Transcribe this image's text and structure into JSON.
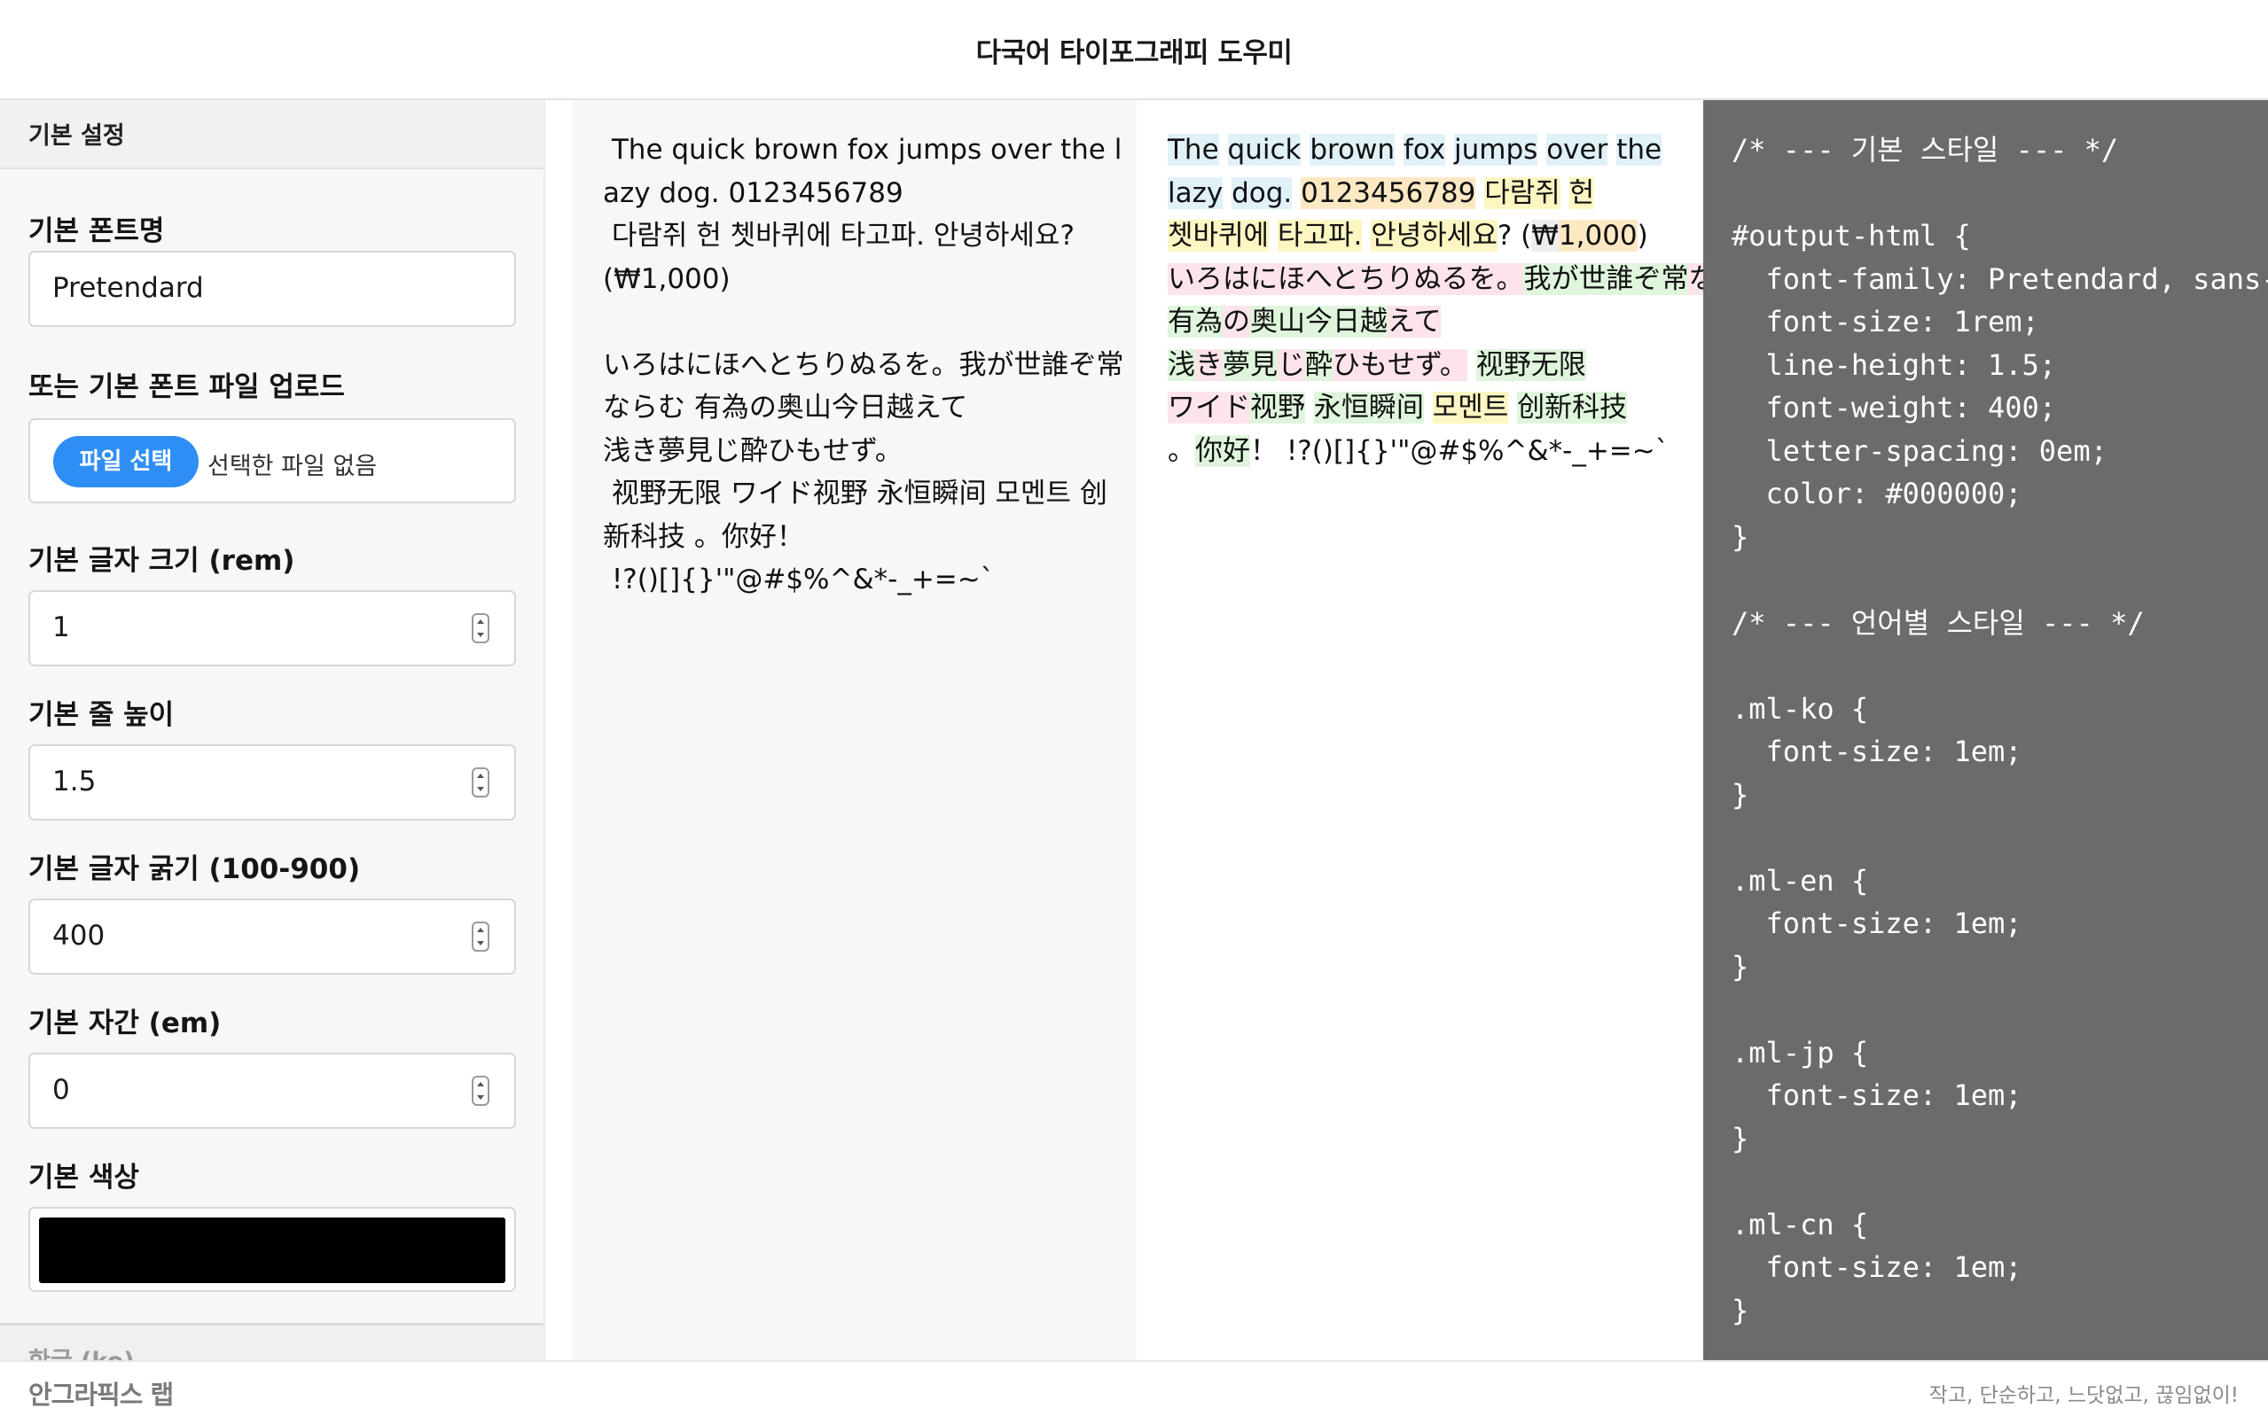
{
  "app": {
    "title": "다국어 타이포그래피 도우미"
  },
  "sidebar": {
    "section_title": "기본 설정",
    "font_name": {
      "label": "기본 폰트명",
      "value": "Pretendard"
    },
    "font_upload": {
      "label": "또는 기본 폰트 파일 업로드",
      "button": "파일 선택",
      "status": "선택한 파일 없음"
    },
    "font_size": {
      "label": "기본 글자 크기 (rem)",
      "value": "1"
    },
    "line_height": {
      "label": "기본 줄 높이",
      "value": "1.5"
    },
    "font_weight": {
      "label": "기본 글자 굵기 (100-900)",
      "value": "400"
    },
    "letter_spacing": {
      "label": "기본 자간 (em)",
      "value": "0"
    },
    "color": {
      "label": "기본 색상",
      "value": "#000000"
    },
    "next_section_title": "한글 (ko)"
  },
  "preview_plain": {
    "text": " The quick brown fox jumps over the lazy dog. 0123456789\n 다람쥐 헌 쳇바퀴에 타고파. 안녕하세요? (₩1,000)\n\nいろはにほへとちりぬるを。我が世誰ぞ常ならむ 有為の奥山今日越えて\n浅き夢見じ酔ひもせず。\n 视野无限 ワイド视野 永恒瞬间 모멘트 创新科技 。你好！\n !?()[]{}'\"@#$%^&*-_+=~`"
  },
  "preview_marked": {
    "lines": [
      [
        {
          "t": "The",
          "c": "en"
        },
        {
          "t": " ",
          "c": ""
        },
        {
          "t": "quick",
          "c": "en"
        },
        {
          "t": " ",
          "c": ""
        },
        {
          "t": "brown",
          "c": "en"
        },
        {
          "t": " ",
          "c": ""
        },
        {
          "t": "fox",
          "c": "en"
        },
        {
          "t": " ",
          "c": ""
        },
        {
          "t": "jumps",
          "c": "en"
        },
        {
          "t": " ",
          "c": ""
        },
        {
          "t": "over",
          "c": "en"
        },
        {
          "t": " ",
          "c": ""
        },
        {
          "t": "the",
          "c": "en"
        }
      ],
      [
        {
          "t": "lazy",
          "c": "en"
        },
        {
          "t": " ",
          "c": ""
        },
        {
          "t": "dog.",
          "c": "en"
        },
        {
          "t": " ",
          "c": ""
        },
        {
          "t": "0123456789",
          "c": "num"
        },
        {
          "t": " ",
          "c": ""
        },
        {
          "t": "다람쥐",
          "c": "ko"
        },
        {
          "t": " ",
          "c": ""
        },
        {
          "t": "헌",
          "c": "ko"
        }
      ],
      [
        {
          "t": "쳇바퀴에",
          "c": "ko"
        },
        {
          "t": " ",
          "c": ""
        },
        {
          "t": "타고파.",
          "c": "ko"
        },
        {
          "t": " ",
          "c": ""
        },
        {
          "t": "안녕하세요",
          "c": "ko"
        },
        {
          "t": "? (",
          "c": ""
        },
        {
          "t": "₩",
          "c": "sym"
        },
        {
          "t": "1,000",
          "c": "num"
        },
        {
          "t": ")",
          "c": ""
        }
      ],
      [
        {
          "t": "いろはにほへとちりぬるを。",
          "c": "jp"
        },
        {
          "t": "我が世誰ぞ常",
          "c": "cn"
        },
        {
          "t": "なら",
          "c": "jp"
        }
      ],
      [
        {
          "t": "有為",
          "c": "cn"
        },
        {
          "t": "の",
          "c": "jp"
        },
        {
          "t": "奥山今日越",
          "c": "cn"
        },
        {
          "t": "えて",
          "c": "jp"
        }
      ],
      [
        {
          "t": "浅",
          "c": "cn"
        },
        {
          "t": "き",
          "c": "jp"
        },
        {
          "t": "夢見",
          "c": "cn"
        },
        {
          "t": "じ",
          "c": "jp"
        },
        {
          "t": "酔",
          "c": "cn"
        },
        {
          "t": "ひもせず。",
          "c": "jp"
        },
        {
          "t": " ",
          "c": ""
        },
        {
          "t": "视野无限",
          "c": "cn"
        }
      ],
      [
        {
          "t": "ワイド",
          "c": "jp"
        },
        {
          "t": "视野",
          "c": "cn"
        },
        {
          "t": " ",
          "c": ""
        },
        {
          "t": "永恒瞬间",
          "c": "cn"
        },
        {
          "t": " ",
          "c": ""
        },
        {
          "t": "모멘트",
          "c": "ko"
        },
        {
          "t": " ",
          "c": ""
        },
        {
          "t": "创新科技",
          "c": "cn"
        }
      ],
      [
        {
          "t": "。",
          "c": ""
        },
        {
          "t": "你好",
          "c": "cn"
        },
        {
          "t": "！",
          "c": ""
        },
        {
          "t": " !?()[]{}'\"@#$%^&*-_+=~`",
          "c": ""
        }
      ]
    ]
  },
  "code": {
    "text": "/* --- 기본 스타일 --- */\n\n#output-html {\n  font-family: Pretendard, sans-serif;\n  font-size: 1rem;\n  line-height: 1.5;\n  font-weight: 400;\n  letter-spacing: 0em;\n  color: #000000;\n}\n\n/* --- 언어별 스타일 --- */\n\n.ml-ko {\n  font-size: 1em;\n}\n\n.ml-en {\n  font-size: 1em;\n}\n\n.ml-jp {\n  font-size: 1em;\n}\n\n.ml-cn {\n  font-size: 1em;\n}"
  },
  "footer": {
    "logo": "안그라픽스 랩",
    "tagline": "작고, 단순하고, 느닷없고, 끊임없이!"
  },
  "colors": {
    "accent": "#2f8ef4",
    "code_bg": "#6b6b6b",
    "en": "#e1f1f8",
    "ko": "#fdf6c2",
    "jp": "#fde4ea",
    "cn": "#dff6dd",
    "num": "#fde8c4"
  }
}
